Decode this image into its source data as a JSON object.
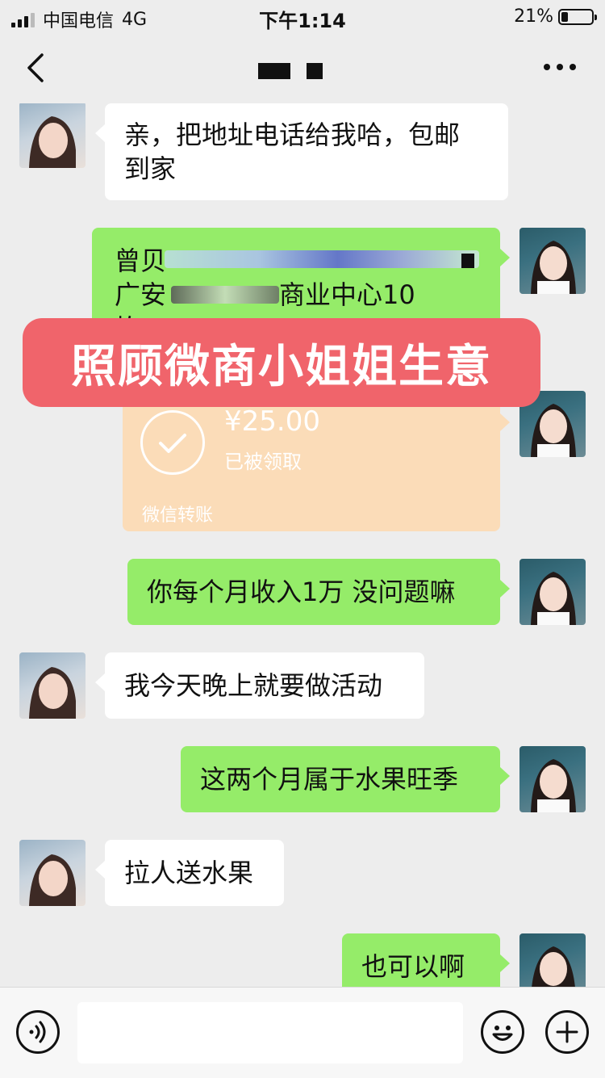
{
  "status_bar": {
    "carrier": "中国电信",
    "network": "4G",
    "time": "下午1:14",
    "battery_text": "21%",
    "battery_level": 0.21
  },
  "nav": {
    "back_icon": "chevron-left-icon",
    "more_icon": "ellipsis-icon"
  },
  "messages": [
    {
      "side": "left",
      "text_line1": "亲，把地址电话给我哈，包邮",
      "text_line2": "到家"
    },
    {
      "side": "right",
      "text_line1": "曾贝",
      "text_line2": "广安",
      "text_line2b": "商业中心10",
      "text_line3": "栋"
    },
    {
      "side": "right",
      "type": "transfer",
      "amount": "¥25.00",
      "status": "已被领取",
      "footer": "微信转账"
    },
    {
      "side": "right",
      "text": "你每个月收入1万 没问题嘛"
    },
    {
      "side": "left",
      "text": "我今天晚上就要做活动"
    },
    {
      "side": "right",
      "text": "这两个月属于水果旺季"
    },
    {
      "side": "left",
      "text": "拉人送水果"
    },
    {
      "side": "right",
      "text": "也可以啊"
    }
  ],
  "overlay_caption": "照顾微商小姐姐生意",
  "input_bar": {
    "voice_icon": "voice-icon",
    "emoji_icon": "emoji-icon",
    "plus_icon": "plus-icon",
    "value": ""
  },
  "colors": {
    "background": "#ededed",
    "bubble_green": "#95ec69",
    "bubble_white": "#ffffff",
    "overlay": "#f0646b",
    "transfer": "#fbdcb8"
  }
}
